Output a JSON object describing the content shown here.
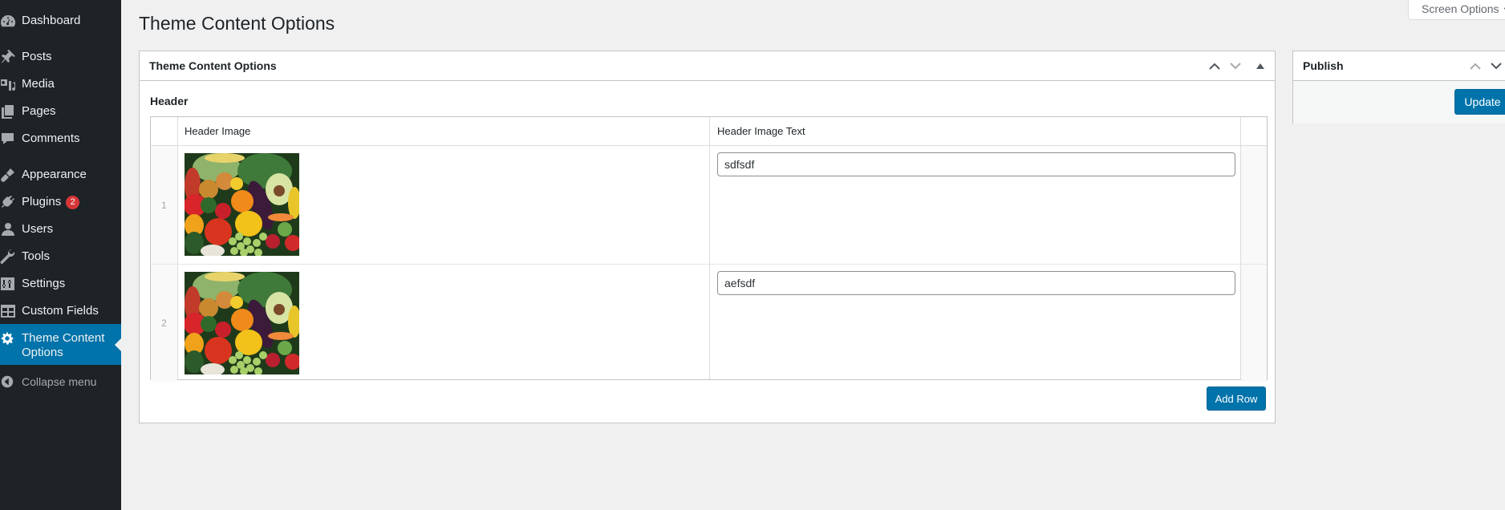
{
  "sidebar": {
    "items": [
      {
        "label": "Dashboard",
        "icon": "dashboard-icon"
      },
      {
        "label": "Posts",
        "icon": "pushpin-icon"
      },
      {
        "label": "Media",
        "icon": "media-icon"
      },
      {
        "label": "Pages",
        "icon": "pages-icon"
      },
      {
        "label": "Comments",
        "icon": "comment-icon"
      },
      {
        "label": "Appearance",
        "icon": "paintbrush-icon"
      },
      {
        "label": "Plugins",
        "icon": "plugin-icon",
        "badge": "2"
      },
      {
        "label": "Users",
        "icon": "user-icon"
      },
      {
        "label": "Tools",
        "icon": "wrench-icon"
      },
      {
        "label": "Settings",
        "icon": "settings-sliders-icon"
      },
      {
        "label": "Custom Fields",
        "icon": "table-icon"
      },
      {
        "label": "Theme Content Options",
        "label_line1": "Theme Content",
        "label_line2": "Options",
        "icon": "gear-icon",
        "active": true
      },
      {
        "label": "Collapse menu",
        "icon": "collapse-arrow-icon"
      }
    ]
  },
  "screen_options": {
    "label": "Screen Options"
  },
  "page": {
    "title": "Theme Content Options"
  },
  "main_box": {
    "title": "Theme Content Options",
    "section_label": "Header",
    "table": {
      "columns": [
        "Header Image",
        "Header Image Text"
      ],
      "rows": [
        {
          "index": "1",
          "image_alt": "Assorted vegetables and fruits",
          "text": "sdfsdf"
        },
        {
          "index": "2",
          "image_alt": "Assorted vegetables and fruits",
          "text": "aefsdf"
        }
      ]
    },
    "add_row_label": "Add Row"
  },
  "publish_box": {
    "title": "Publish",
    "update_label": "Update"
  },
  "colors": {
    "sidebar_bg": "#1d2327",
    "active_menu_bg": "#0073aa",
    "primary_button": "#0073aa",
    "badge": "#d63638",
    "page_bg": "#f0f0f1"
  }
}
